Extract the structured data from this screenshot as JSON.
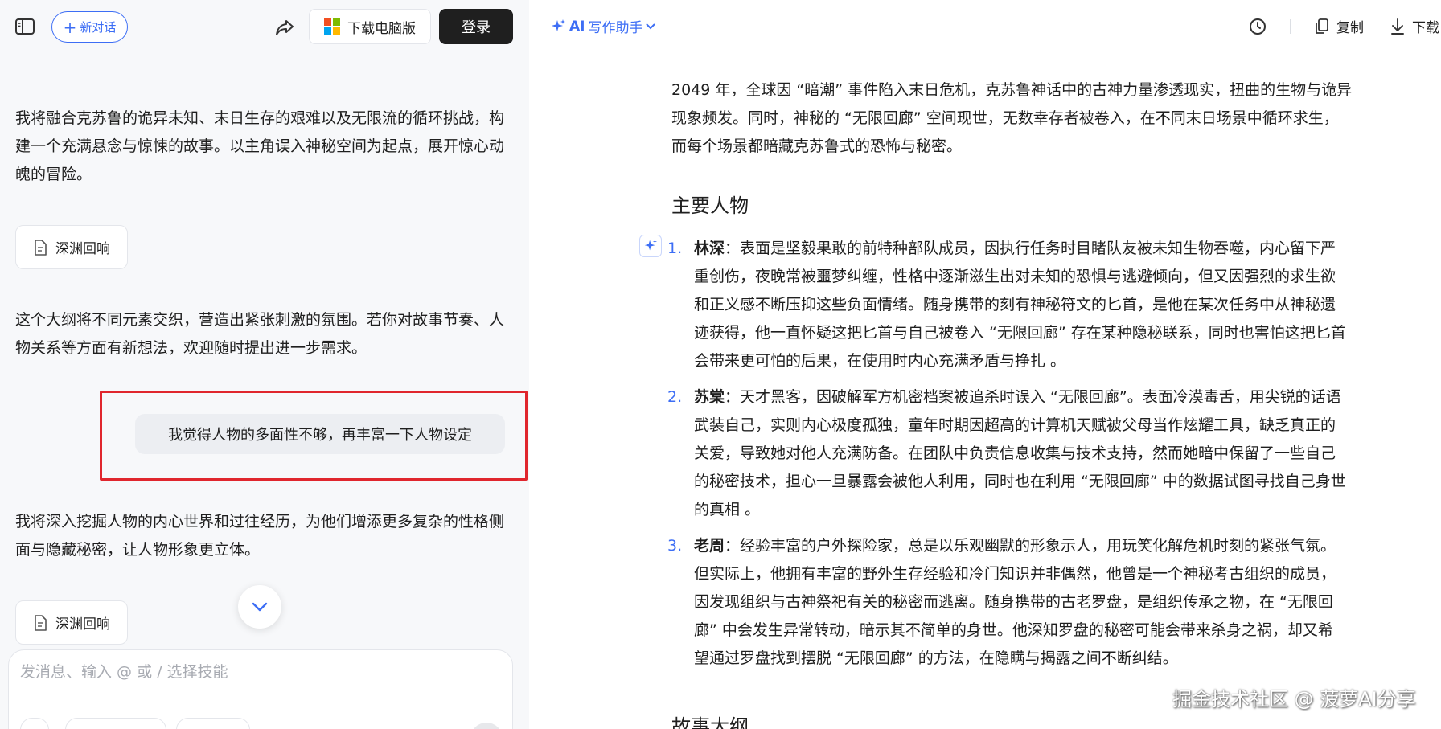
{
  "topbar": {
    "new_chat_label": "新对话",
    "download_pc_label": "下载电脑版",
    "login_label": "登录"
  },
  "chat": {
    "msg1": "我将融合克苏鲁的诡异未知、末日生存的艰难以及无限流的循环挑战，构建一个充满悬念与惊悚的故事。以主角误入神秘空间为起点，展开惊心动魄的冒险。",
    "file1": "深渊回响",
    "msg2": "这个大纲将不同元素交织，营造出紧张刺激的氛围。若你对故事节奏、人物关系等方面有新想法，欢迎随时提出进一步需求。",
    "user_msg": "我觉得人物的多面性不够，再丰富一下人物设定",
    "msg3": "我将深入挖掘人物的内心世界和过往经历，为他们增添更多复杂的性格侧面与隐藏秘密，让人物形象更立体。",
    "file2": "深渊回响"
  },
  "composer": {
    "placeholder": "发消息、输入 @ 或 / 选择技能"
  },
  "doc_header": {
    "ai_prefix": "AI",
    "ai_label": "写作助手",
    "copy_label": "复制",
    "download_label": "下载"
  },
  "doc": {
    "intro_line1": "2049 年，全球因 “暗潮” 事件陷入末日危机，克苏鲁神话中的古神力量渗透现实，扭曲的生物与诡异",
    "intro_line2": "现象频发。同时，神秘的 “无限回廊” 空间现世，无数幸存者被卷入，在不同末日场景中循环求生，",
    "intro_line3": "而每个场景都暗藏克苏鲁式的恐怖与秘密。",
    "heading_characters": "主要人物",
    "characters": [
      {
        "num": "1.",
        "name": "林深",
        "lines": [
          "：表面是坚毅果敢的前特种部队成员，因执行任务时目睹队友被未知生物吞噬，内心留下严",
          "重创伤，夜晚常被噩梦纠缠，性格中逐渐滋生出对未知的恐惧与逃避倾向，但又因强烈的求生欲",
          "和正义感不断压抑这些负面情绪。随身携带的刻有神秘符文的匕首，是他在某次任务中从神秘遗",
          "迹获得，他一直怀疑这把匕首与自己被卷入 “无限回廊” 存在某种隐秘联系，同时也害怕这把匕首",
          "会带来更可怕的后果，在使用时内心充满矛盾与挣扎 。"
        ]
      },
      {
        "num": "2.",
        "name": "苏棠",
        "lines": [
          "：天才黑客，因破解军方机密档案被追杀时误入 “无限回廊”。表面冷漠毒舌，用尖锐的话语",
          "武装自己，实则内心极度孤独，童年时期因超高的计算机天赋被父母当作炫耀工具，缺乏真正的",
          "关爱，导致她对他人充满防备。在团队中负责信息收集与技术支持，然而她暗中保留了一些自己",
          "的秘密技术，担心一旦暴露会被他人利用，同时也在利用 “无限回廊” 中的数据试图寻找自己身世",
          "的真相 。"
        ]
      },
      {
        "num": "3.",
        "name": "老周",
        "lines": [
          "：经验丰富的户外探险家，总是以乐观幽默的形象示人，用玩笑化解危机时刻的紧张气氛。",
          "但实际上，他拥有丰富的野外生存经验和冷门知识并非偶然，他曾是一个神秘考古组织的成员，",
          "因发现组织与古神祭祀有关的秘密而逃离。随身携带的古老罗盘，是组织传承之物，在 “无限回",
          "廊” 中会发生异常转动，暗示其不简单的身世。他深知罗盘的秘密可能会带来杀身之祸，却又希",
          "望通过罗盘找到摆脱 “无限回廊” 的方法，在隐瞒与揭露之间不断纠结。"
        ]
      }
    ],
    "heading_outline": "故事大纲"
  },
  "watermark": "掘金技术社区 @ 菠萝AI分享",
  "colors": {
    "accent": "#3d6ef5",
    "highlight_frame": "#e0262d",
    "login_bg": "#1f1f1f"
  }
}
